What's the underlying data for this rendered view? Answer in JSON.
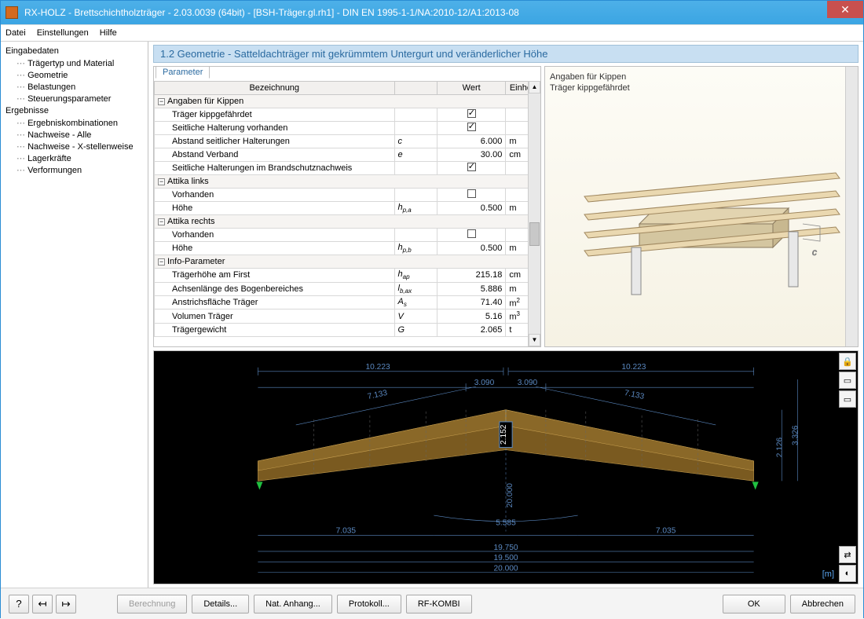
{
  "window": {
    "title": "RX-HOLZ - Brettschichtholzträger - 2.03.0039 (64bit) - [BSH-Träger.gl.rh1] - DIN EN 1995-1-1/NA:2010-12/A1:2013-08",
    "close": "✕"
  },
  "menu": {
    "file": "Datei",
    "settings": "Einstellungen",
    "help": "Hilfe"
  },
  "nav": {
    "group1": "Eingabedaten",
    "items1": [
      "Trägertyp und Material",
      "Geometrie",
      "Belastungen",
      "Steuerungsparameter"
    ],
    "group2": "Ergebnisse",
    "items2": [
      "Ergebniskombinationen",
      "Nachweise - Alle",
      "Nachweise - X-stellenweise",
      "Lagerkräfte",
      "Verformungen"
    ]
  },
  "section": "1.2 Geometrie  -  Satteldachträger mit gekrümmtem Untergurt und veränderlicher Höhe",
  "param": {
    "tab": "Parameter",
    "headers": {
      "c1": "Bezeichnung",
      "c2": "",
      "c3": "Wert",
      "c4": "Einheit"
    },
    "groups": [
      {
        "label": "Angaben für Kippen",
        "rows": [
          {
            "label": "Träger kippgefährdet",
            "sym": "",
            "val": "",
            "unit": "",
            "checked": true
          },
          {
            "label": "Seitliche Halterung vorhanden",
            "sym": "",
            "val": "",
            "unit": "",
            "checked": true
          },
          {
            "label": "Abstand seitlicher Halterungen",
            "sym": "c",
            "val": "6.000",
            "unit": "m"
          },
          {
            "label": "Abstand Verband",
            "sym": "e",
            "val": "30.00",
            "unit": "cm"
          },
          {
            "label": "Seitliche Halterungen im Brandschutznachweis",
            "sym": "",
            "val": "",
            "unit": "",
            "checked": true
          }
        ]
      },
      {
        "label": "Attika links",
        "rows": [
          {
            "label": "Vorhanden",
            "sym": "",
            "val": "",
            "unit": "",
            "checked": false
          },
          {
            "label": "Höhe",
            "sym": "h p,a",
            "val": "0.500",
            "unit": "m"
          }
        ]
      },
      {
        "label": "Attika rechts",
        "rows": [
          {
            "label": "Vorhanden",
            "sym": "",
            "val": "",
            "unit": "",
            "checked": false
          },
          {
            "label": "Höhe",
            "sym": "h p,b",
            "val": "0.500",
            "unit": "m"
          }
        ]
      },
      {
        "label": "Info-Parameter",
        "rows": [
          {
            "label": "Trägerhöhe am First",
            "sym": "h ap",
            "val": "215.18",
            "unit": "cm"
          },
          {
            "label": "Achsenlänge des Bogenbereiches",
            "sym": "l b,ax",
            "val": "5.886",
            "unit": "m"
          },
          {
            "label": "Anstrichsfläche Träger",
            "sym": "A s",
            "val": "71.40",
            "unit": "m²"
          },
          {
            "label": "Volumen Träger",
            "sym": "V",
            "val": "5.16",
            "unit": "m³"
          },
          {
            "label": "Trägergewicht",
            "sym": "G",
            "val": "2.065",
            "unit": "t"
          }
        ]
      }
    ]
  },
  "preview": {
    "line1": "Angaben für Kippen",
    "line2": "Träger kippgefährdet",
    "dim_c": "c"
  },
  "drawing": {
    "unit": "[m]",
    "dims": {
      "top_left": "10.223",
      "top_mid_l": "3.090",
      "top_mid_r": "3.090",
      "top_right": "10.223",
      "slope_l": "7.133",
      "slope_r": "7.133",
      "h_first": "2.152",
      "h_side_inner": "2.126",
      "h_side_outer": "3.326",
      "span_under": "20.000",
      "bot_l": "7.035",
      "bot_mid": "5.585",
      "bot_r": "7.035",
      "b1": "19.750",
      "b2": "19.500",
      "b3": "20.000"
    }
  },
  "footer": {
    "help": "?",
    "prev": "⇤",
    "next": "⇥",
    "calc": "Berechnung",
    "details": "Details...",
    "nat": "Nat. Anhang...",
    "proto": "Protokoll...",
    "rf": "RF-KOMBI",
    "ok": "OK",
    "cancel": "Abbrechen"
  }
}
